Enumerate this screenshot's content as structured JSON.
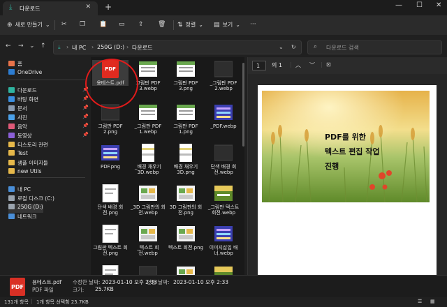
{
  "window": {
    "tab_title": "다운로드",
    "new_tab": "+",
    "tab_close": "✕",
    "minimize": "—",
    "maximize": "☐",
    "close": "✕"
  },
  "commandbar": {
    "new_label": "새로 만들기",
    "sort_label": "정렬",
    "view_label": "보기",
    "more": "···"
  },
  "address": {
    "segments": [
      "내 PC",
      "250G (D:)",
      "다운로드"
    ],
    "search_placeholder": "다운로드 검색"
  },
  "sidebar": {
    "items": [
      {
        "label": "홈",
        "color": "#e8734a"
      },
      {
        "label": "OneDrive",
        "color": "#2d7dd2"
      },
      {
        "label": "다운로드",
        "color": "#2fb4a0",
        "pinned": true
      },
      {
        "label": "바탕 화면",
        "color": "#3b8fe0",
        "pinned": true
      },
      {
        "label": "문서",
        "color": "#8a9bb0",
        "pinned": true
      },
      {
        "label": "사진",
        "color": "#4aa0e8",
        "pinned": true
      },
      {
        "label": "음악",
        "color": "#e05a78",
        "pinned": true
      },
      {
        "label": "동영상",
        "color": "#8b5fd6",
        "pinned": true
      },
      {
        "label": "티스토리 관련",
        "color": "#e6b84a"
      },
      {
        "label": "Test",
        "color": "#e6b84a"
      },
      {
        "label": "샘플 이미지들",
        "color": "#e6b84a"
      },
      {
        "label": "new Utils",
        "color": "#e6b84a"
      },
      {
        "label": "내 PC",
        "color": "#4a8fd8"
      },
      {
        "label": "로컬 디스크 (C:)",
        "color": "#9aa4ae"
      },
      {
        "label": "250G (D:)",
        "color": "#9aa4ae"
      },
      {
        "label": "네트워크",
        "color": "#4a8fd8"
      }
    ]
  },
  "files": [
    {
      "name": "용테스트.pdf",
      "kind": "pdf"
    },
    {
      "name": "그림판 PDF 3.webp",
      "kind": "sheet"
    },
    {
      "name": "그림판 PDF 3.png",
      "kind": "sheet"
    },
    {
      "name": "_그림판 PDF 2.webp",
      "kind": "dark"
    },
    {
      "name": "그림판 PDF 2.png",
      "kind": "dark"
    },
    {
      "name": "_그림판 PDF 1.webp",
      "kind": "sheet"
    },
    {
      "name": "그림판 PDF 1.png",
      "kind": "sheet"
    },
    {
      "name": "_PDF.webp",
      "kind": "noise"
    },
    {
      "name": "PDF.png",
      "kind": "noise"
    },
    {
      "name": "_배경 채우기 3D.webp",
      "kind": "paint"
    },
    {
      "name": "배경 채우기 3D.png",
      "kind": "paint"
    },
    {
      "name": "단색 배경 회전.webp",
      "kind": "dark"
    },
    {
      "name": "단색 배경 회전.png",
      "kind": "white"
    },
    {
      "name": "_3D 그림판의 회전.webp",
      "kind": "tile"
    },
    {
      "name": "3D 그림판의 회전.png",
      "kind": "tile"
    },
    {
      "name": "_그림판 텍스트 회전.webp",
      "kind": "green"
    },
    {
      "name": "그림판 텍스트 회전.png",
      "kind": "white"
    },
    {
      "name": "_텍스트 회전.webp",
      "kind": "tile"
    },
    {
      "name": "텍스트 회전.png",
      "kind": "tile"
    },
    {
      "name": "이미지삽입 배너.webp",
      "kind": "noise"
    },
    {
      "name": "",
      "kind": "white"
    },
    {
      "name": "",
      "kind": "dark"
    },
    {
      "name": "",
      "kind": "tile"
    },
    {
      "name": "",
      "kind": "green"
    }
  ],
  "preview": {
    "page_num": "1",
    "page_of": "의 1",
    "title_lines": [
      "PDF를 위한",
      "텍스트 편집 작업",
      "진행"
    ]
  },
  "details": {
    "file_name": "용테스트.pdf",
    "file_type": "PDF 파일",
    "modified_key": "수정한 날짜:",
    "modified_val": "2023-01-10 오후 2:33",
    "created_key": "만든 날짜:",
    "created_val": "2023-01-10 오후 2:33",
    "size_key": "크기:",
    "size_val": "25.7KB"
  },
  "status": {
    "count": "131개 항목",
    "selected": "1개 항목 선택함 25.7KB"
  }
}
